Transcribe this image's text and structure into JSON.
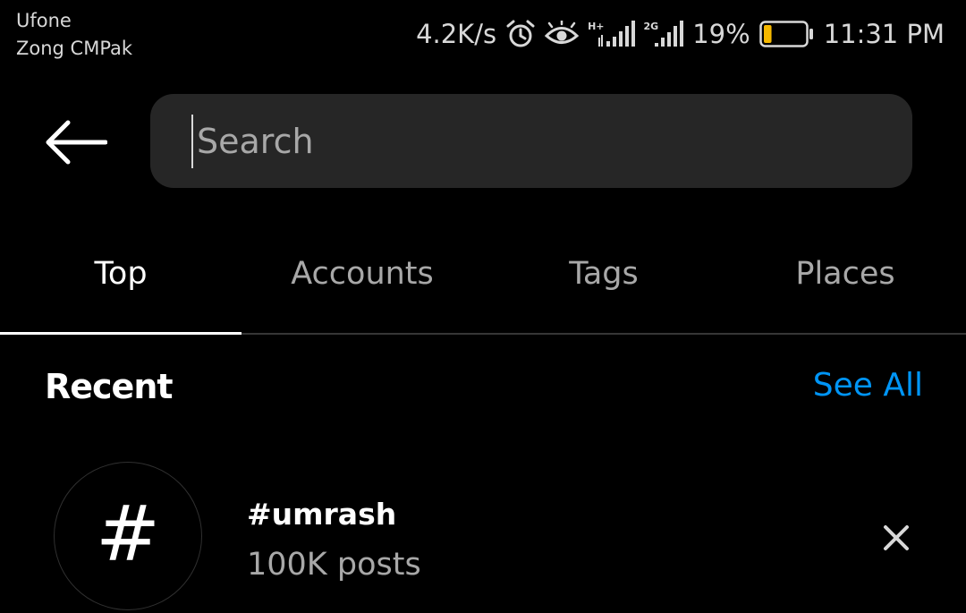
{
  "status_bar": {
    "carrier_1": "Ufone",
    "carrier_2": "Zong CMPak",
    "net_speed": "4.2K/s",
    "sim1_network": "H+",
    "sim2_network": "2G",
    "battery_percent_text": "19%",
    "battery_level": 0.19,
    "time": "11:31 PM",
    "icons": [
      "alarm-icon",
      "eye-comfort-icon",
      "signal-icon",
      "signal-icon",
      "battery-icon"
    ]
  },
  "header": {
    "back_icon": "back-arrow-icon",
    "search_placeholder": "Search",
    "search_value": ""
  },
  "tabs": [
    {
      "label": "Top",
      "active": true
    },
    {
      "label": "Accounts",
      "active": false
    },
    {
      "label": "Tags",
      "active": false
    },
    {
      "label": "Places",
      "active": false
    }
  ],
  "recent": {
    "title": "Recent",
    "see_all": "See All",
    "items": [
      {
        "icon_glyph": "#",
        "name": "#umrash",
        "subtitle": "100K posts",
        "remove_icon": "close-icon"
      }
    ]
  },
  "colors": {
    "background": "#000000",
    "search_field": "#262626",
    "link": "#0095f6",
    "secondary_text": "#a8a8a8",
    "battery_fill": "#f5b800"
  }
}
